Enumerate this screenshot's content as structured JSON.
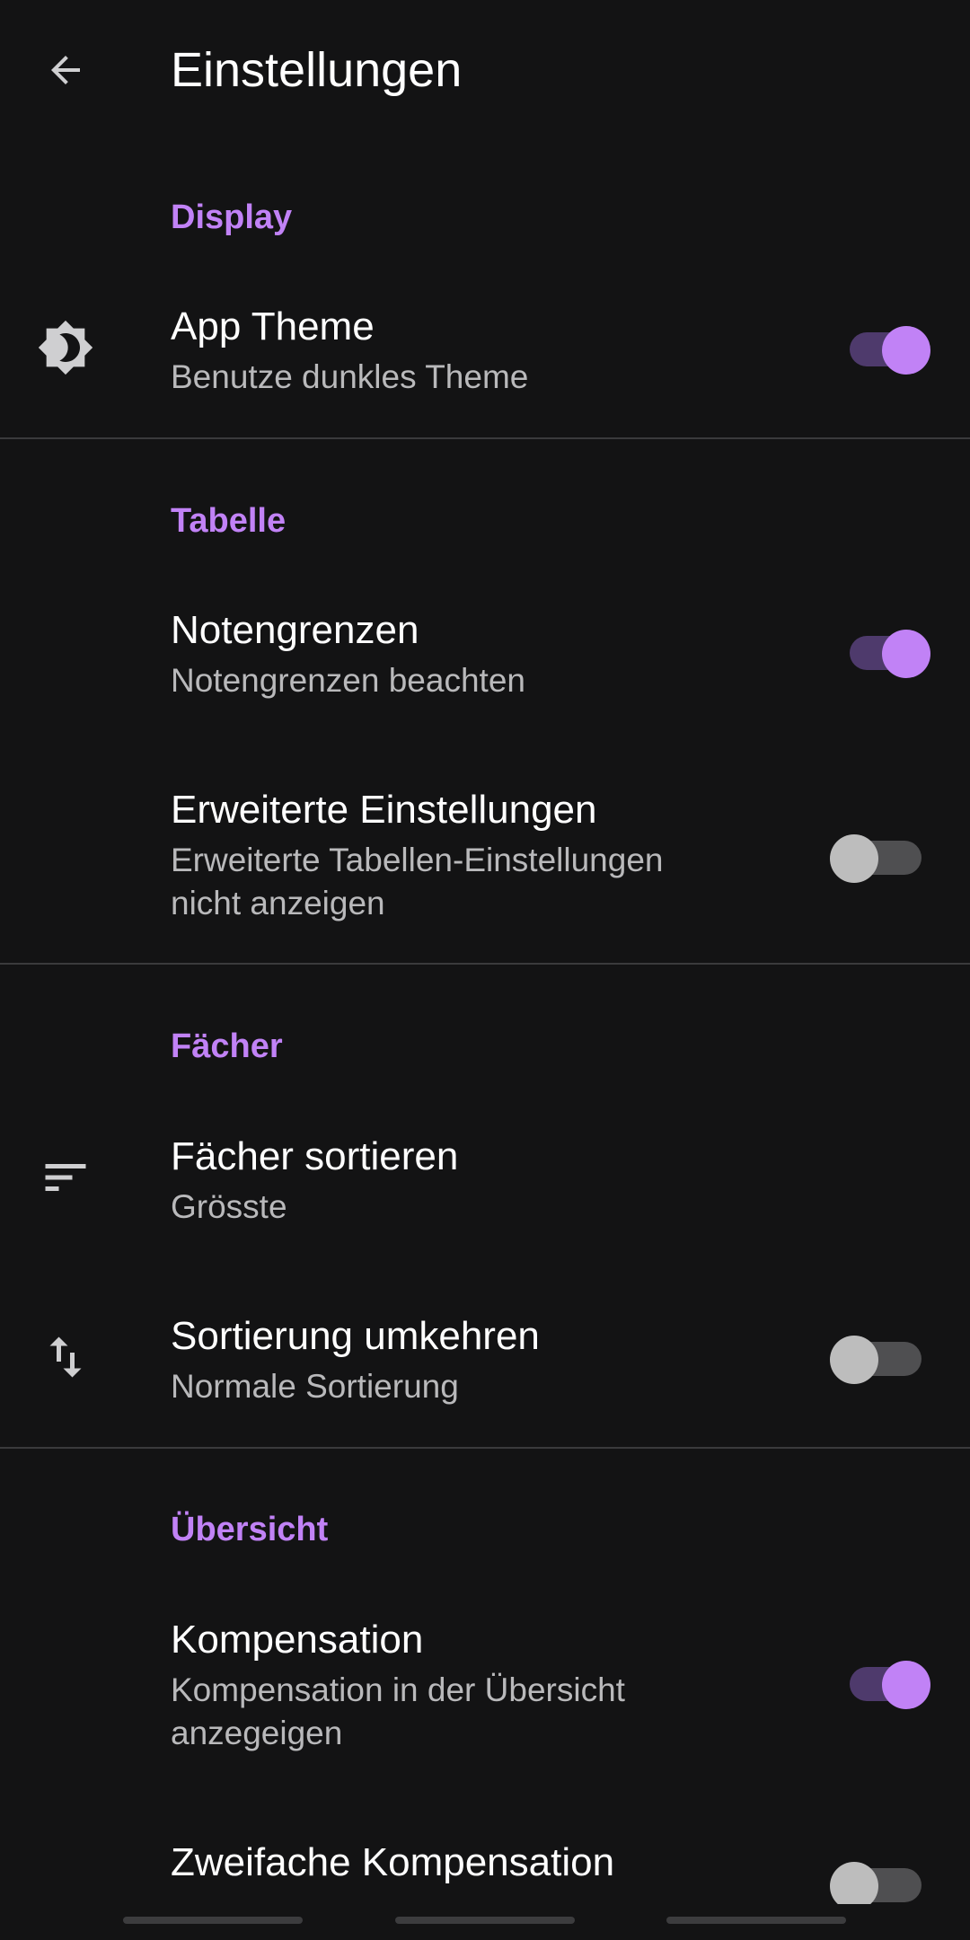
{
  "toolbar": {
    "title": "Einstellungen",
    "back_icon": "arrow-back-icon"
  },
  "colors": {
    "background": "#131314",
    "accent": "#c182f6",
    "switch_track_on": "#4e3a6c",
    "switch_track_off": "#4f4f51",
    "switch_thumb_off": "#bdbdbd",
    "summary_text": "#b9b9bb"
  },
  "sections": {
    "display": {
      "header": "Display",
      "app_theme": {
        "title": "App Theme",
        "summary": "Benutze dunkles Theme",
        "icon": "brightness-icon",
        "enabled": true
      }
    },
    "tabelle": {
      "header": "Tabelle",
      "notengrenzen": {
        "title": "Notengrenzen",
        "summary": "Notengrenzen beachten",
        "enabled": true
      },
      "erweiterte": {
        "title": "Erweiterte Einstellungen",
        "summary": "Erweiterte Tabellen-Einstellungen nicht anzeigen",
        "enabled": false
      }
    },
    "faecher": {
      "header": "Fächer",
      "sortieren": {
        "title": "Fächer sortieren",
        "summary": "Grösste",
        "icon": "sort-icon"
      },
      "umkehren": {
        "title": "Sortierung umkehren",
        "summary": "Normale Sortierung",
        "icon": "swap-vert-icon",
        "enabled": false
      }
    },
    "uebersicht": {
      "header": "Übersicht",
      "kompensation": {
        "title": "Kompensation",
        "summary": "Kompensation in der Übersicht anzegeigen",
        "enabled": true
      },
      "zweifache": {
        "title": "Zweifache Kompensation",
        "summary": "",
        "enabled": false
      }
    }
  }
}
